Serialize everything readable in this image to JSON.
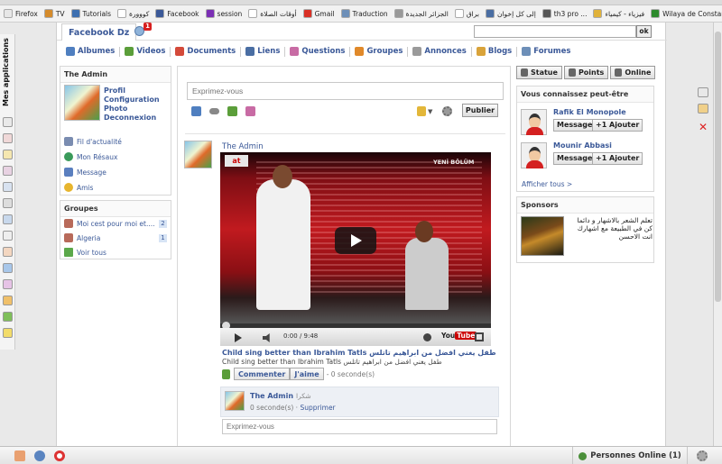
{
  "bookmarks": [
    {
      "label": "Firefox",
      "color": "#e7e7e7"
    },
    {
      "label": "TV",
      "color": "#d58b2b"
    },
    {
      "label": "Tutorials",
      "color": "#3c6fb0"
    },
    {
      "label": "كووورة",
      "color": "#ffffff"
    },
    {
      "label": "Facebook",
      "color": "#3b5998"
    },
    {
      "label": "session",
      "color": "#7b2fb5"
    },
    {
      "label": "أوقات الصلاة",
      "color": "#ffffff"
    },
    {
      "label": "Gmail",
      "color": "#d93025"
    },
    {
      "label": "Traduction",
      "color": "#6d8fb8"
    },
    {
      "label": "الجزائر الجديدة",
      "color": "#999999"
    },
    {
      "label": "براق",
      "color": "#ffffff"
    },
    {
      "label": "إلى كل إخوان",
      "color": "#4a6ea3"
    },
    {
      "label": "th3 pro ...",
      "color": "#555555"
    },
    {
      "label": "فيزياء - كيمياء",
      "color": "#e0b23a"
    },
    {
      "label": "Wilaya de Constantine",
      "color": "#2d8a2d"
    }
  ],
  "left_apps": {
    "title": "Mes applications"
  },
  "header": {
    "site_title": "Facebook Dz",
    "notification_count": "1",
    "search_placeholder": "",
    "search_button": "ok"
  },
  "nav": [
    {
      "label": "Albumes",
      "color": "#4f7fc0"
    },
    {
      "label": "Videos",
      "color": "#5b9e3a"
    },
    {
      "label": "Documents",
      "color": "#d44a3a"
    },
    {
      "label": "Liens",
      "color": "#4a6ea3"
    },
    {
      "label": "Questions",
      "color": "#c86ba4"
    },
    {
      "label": "Groupes",
      "color": "#e0892a"
    },
    {
      "label": "Annonces",
      "color": "#9a9a9a"
    },
    {
      "label": "Blogs",
      "color": "#d9a33a"
    },
    {
      "label": "Forumes",
      "color": "#6d8fb8"
    }
  ],
  "admin_panel": {
    "title": "The Admin",
    "links": [
      "Profil",
      "Configuration",
      "Photo",
      "Deconnexion"
    ],
    "side_links": [
      {
        "label": "Fil d'actualité",
        "color": "#7a8cb0"
      },
      {
        "label": "Mon Résaux",
        "color": "#3a9a5a"
      },
      {
        "label": "Message",
        "color": "#5a7fbf"
      },
      {
        "label": "Amis",
        "color": "#e7b52e"
      }
    ]
  },
  "groups_panel": {
    "title": "Groupes",
    "groups": [
      {
        "label": "Moi cest pour moi et....",
        "count": "2"
      },
      {
        "label": "Algeria",
        "count": "1"
      }
    ],
    "see_all": "Voir tous"
  },
  "composer": {
    "placeholder": "Exprimez-vous",
    "publish": "Publier"
  },
  "post": {
    "author": "The Admin",
    "video": {
      "channel_logo": "at",
      "caption": "YENİ BÖLÜM",
      "time": "0:00 / 9:48",
      "brand": "You",
      "brand_tube": "Tube"
    },
    "title": "Child sing better than Ibrahim Tatls طفل يغني افضل من ابراهيم تاتلس",
    "description": "Child sing better than Ibrahim Tatls طفل يغني افضل من ابراهيم تاتلس",
    "comment_button": "Commenter",
    "like_button": "J'aime",
    "time": "- 0 seconde(s)",
    "comment": {
      "author": "The Admin",
      "text": "شكرا",
      "time": "0 seconde(s) ·",
      "delete": "Supprimer"
    },
    "comment_placeholder": "Exprimez-vous"
  },
  "right_buttons": [
    "Statue",
    "Points",
    "Online"
  ],
  "people_panel": {
    "title": "Vous connaissez peut-être",
    "people": [
      {
        "name": "Rafik El Monopole",
        "message": "Message",
        "add": "+1 Ajouter"
      },
      {
        "name": "Mounir Abbasi",
        "message": "Message",
        "add": "+1 Ajouter"
      }
    ],
    "see_all": "Afficher tous >"
  },
  "sponsors": {
    "title": "Sponsors",
    "text": "تعلم الشعر بالاشهار و دائما كن في الطبيعة مع اشهارك انت الاحسن"
  },
  "bottom": {
    "online_label": "Personnes Online (1)"
  }
}
